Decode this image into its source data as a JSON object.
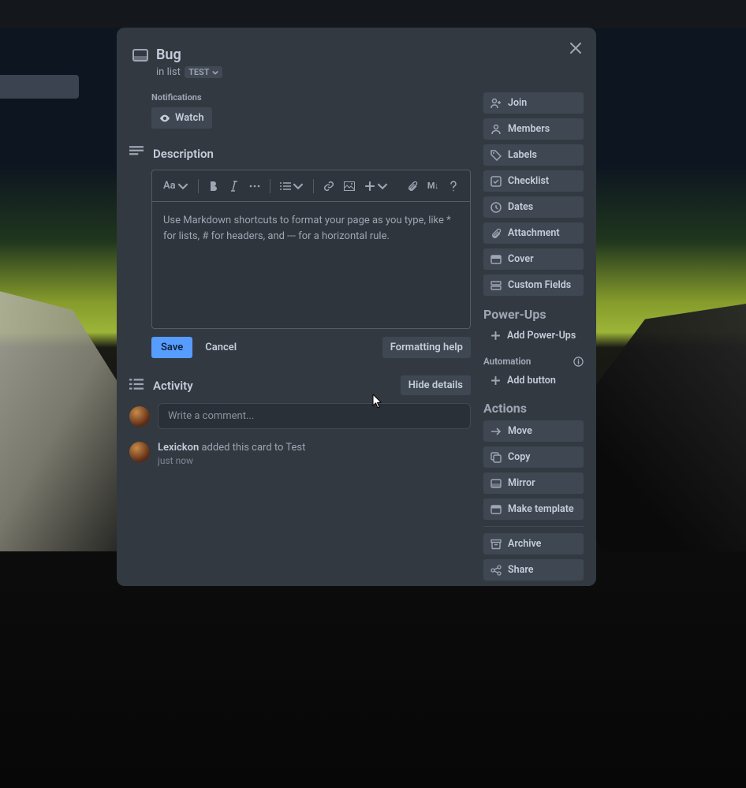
{
  "card": {
    "title": "Bug",
    "inlist_prefix": "in list",
    "list_name": "TEST"
  },
  "notifications": {
    "label": "Notifications",
    "watch": "Watch"
  },
  "description": {
    "heading": "Description",
    "placeholder": "Use Markdown shortcuts to format your page as you type, like * for lists, # for headers, and --- for a horizontal rule.",
    "toolbar_text": "Aa",
    "markdown_toggle": "M↓"
  },
  "editor_actions": {
    "save": "Save",
    "cancel": "Cancel",
    "formatting_help": "Formatting help"
  },
  "activity": {
    "heading": "Activity",
    "hide_details": "Hide details",
    "comment_placeholder": "Write a comment...",
    "entry_user": "Lexickon",
    "entry_text": " added this card to Test",
    "entry_time": "just now"
  },
  "sidebar": {
    "join": "Join",
    "members": "Members",
    "labels": "Labels",
    "checklist": "Checklist",
    "dates": "Dates",
    "attachment": "Attachment",
    "cover": "Cover",
    "custom_fields": "Custom Fields",
    "powerups_label": "Power-Ups",
    "add_powerups": "Add Power-Ups",
    "automation_label": "Automation",
    "add_button": "Add button",
    "actions_label": "Actions",
    "move": "Move",
    "copy": "Copy",
    "mirror": "Mirror",
    "make_template": "Make template",
    "archive": "Archive",
    "share": "Share"
  }
}
